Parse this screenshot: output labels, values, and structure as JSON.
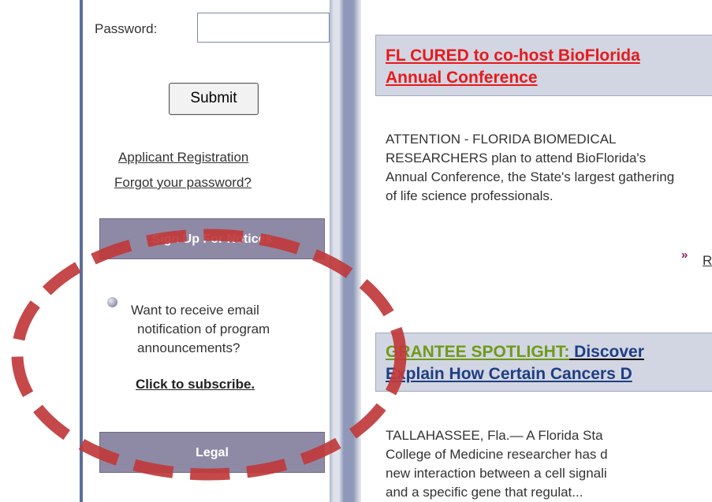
{
  "sidebar": {
    "password_label": "Password:",
    "password_value": "",
    "submit_label": "Submit",
    "applicant_registration": "Applicant Registration",
    "forgot_password": "Forgot your password?",
    "signup_header": "Sign Up For Notices",
    "notification_lines": [
      "Want to receive email",
      "notification of program",
      "announcements?"
    ],
    "subscribe_link": "Click to subscribe.",
    "legal_header": "Legal"
  },
  "content": {
    "article1": {
      "headline_line1": "FL CURED to co-host BioFlorida",
      "headline_line2": "Annual Conference",
      "body_lines": [
        "ATTENTION - FLORIDA BIOMEDICAL",
        "RESEARCHERS plan to attend BioFlorida's",
        "Annual Conference, the State's largest gathering",
        "of life science professionals."
      ],
      "more_arrow": "»",
      "more_link": "R"
    },
    "article2": {
      "headline_prefix": "GRANTEE SPOTLIGHT:",
      "headline_rest_line1": " Discover",
      "headline_line2": "Explain How Certain Cancers D",
      "body_lines": [
        "TALLAHASSEE, Fla.— A Florida Sta",
        "College of Medicine researcher has d",
        "new interaction between a cell signali",
        "and a specific gene that regulat..."
      ]
    }
  },
  "colors": {
    "annotation": "#c0393b",
    "headline_red": "#e8191b",
    "spotlight_green": "#6f9a1a",
    "headline_navy": "#1f3e83",
    "box_header": "#8e8aa6"
  }
}
